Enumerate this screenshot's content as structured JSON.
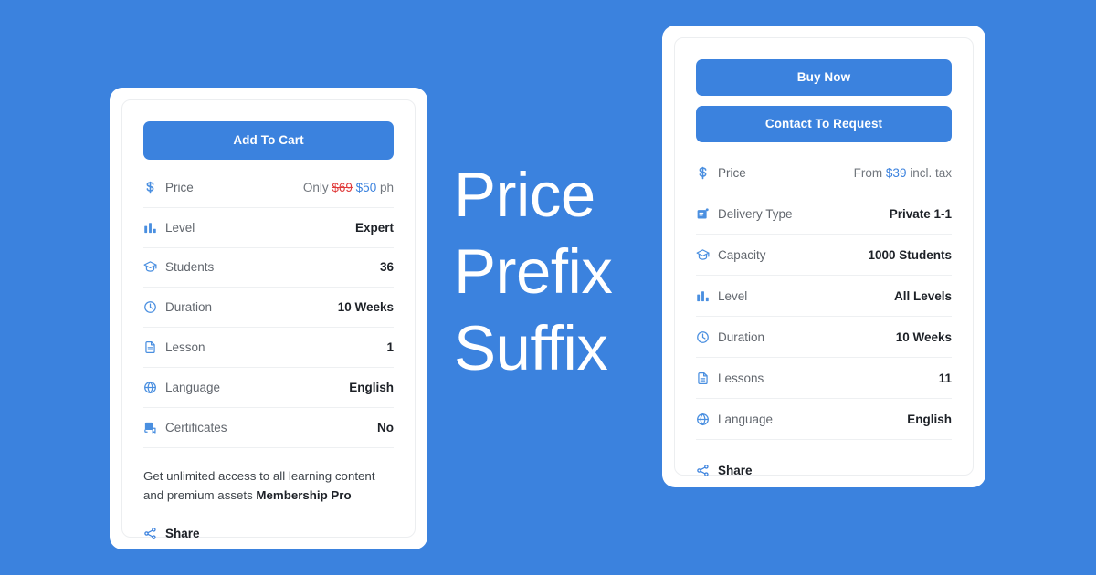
{
  "theme": {
    "background": "#3b82de",
    "accent": "#3b82de",
    "card_background": "#ffffff",
    "label_color": "#62676e",
    "value_color": "#1d2127",
    "old_price_color": "#e03b3b",
    "new_price_color": "#3b82de",
    "divider_color": "#eef0f2"
  },
  "headline": {
    "line1": "Price",
    "line2": "Prefix",
    "line3": "Suffix"
  },
  "left_card": {
    "primary_button": "Add To Cart",
    "specs": [
      {
        "icon": "dollar-icon",
        "label": "Price",
        "value_type": "price",
        "prefix": "Only",
        "old_price": "$69",
        "new_price": "$50",
        "suffix": "ph"
      },
      {
        "icon": "bar-chart-icon",
        "label": "Level",
        "value": "Expert"
      },
      {
        "icon": "graduation-cap-icon",
        "label": "Students",
        "value": "36"
      },
      {
        "icon": "clock-icon",
        "label": "Duration",
        "value": "10 Weeks"
      },
      {
        "icon": "document-icon",
        "label": "Lesson",
        "value": "1"
      },
      {
        "icon": "globe-icon",
        "label": "Language",
        "value": "English"
      },
      {
        "icon": "certificate-icon",
        "label": "Certificates",
        "value": "No"
      }
    ],
    "note_text": "Get unlimited access to all learning content and premium assets ",
    "note_bold": "Membership Pro",
    "share_label": "Share",
    "share_icon": "share-icon"
  },
  "right_card": {
    "primary_button": "Buy Now",
    "secondary_button": "Contact To Request",
    "specs": [
      {
        "icon": "dollar-icon",
        "label": "Price",
        "value_type": "price",
        "prefix": "From",
        "new_price": "$39",
        "suffix": "incl. tax"
      },
      {
        "icon": "id-card-icon",
        "label": "Delivery Type",
        "value": "Private 1-1"
      },
      {
        "icon": "graduation-cap-icon",
        "label": "Capacity",
        "value": "1000 Students"
      },
      {
        "icon": "bar-chart-icon",
        "label": "Level",
        "value": "All Levels"
      },
      {
        "icon": "clock-icon",
        "label": "Duration",
        "value": "10 Weeks"
      },
      {
        "icon": "document-icon",
        "label": "Lessons",
        "value": "11"
      },
      {
        "icon": "globe-icon",
        "label": "Language",
        "value": "English"
      }
    ],
    "share_label": "Share",
    "share_icon": "share-icon"
  }
}
